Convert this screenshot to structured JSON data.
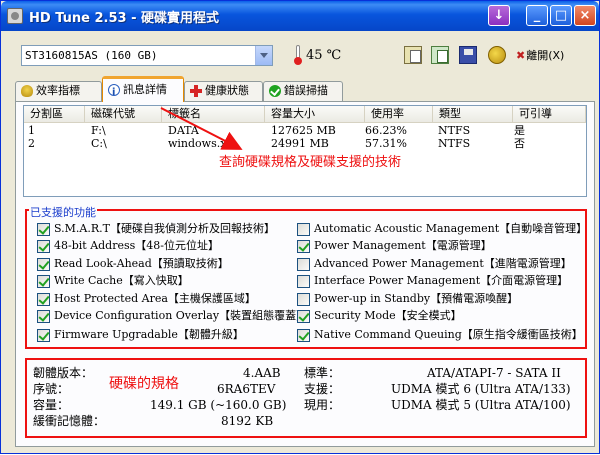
{
  "window": {
    "title": "HD Tune 2.53 - 硬碟實用程式"
  },
  "toolbar": {
    "drive": "ST3160815AS (160 GB)",
    "temperature": "45 ℃",
    "exit_label": "離開(X)",
    "icons": [
      "copy-text-icon",
      "copy-screenshot-icon",
      "save-icon",
      "options-icon"
    ]
  },
  "tabs": [
    {
      "label": "效率指標",
      "icon": "benchmark-icon",
      "selected": false
    },
    {
      "label": "訊息詳情",
      "icon": "info-icon",
      "selected": true
    },
    {
      "label": "健康狀態",
      "icon": "health-icon",
      "selected": false
    },
    {
      "label": "錯誤掃描",
      "icon": "error-scan-icon",
      "selected": false
    }
  ],
  "partitions": {
    "columns": [
      "分割區",
      "磁碟代號",
      "標籤名",
      "容量大小",
      "使用率",
      "類型",
      "可引導"
    ],
    "rows": [
      [
        "1",
        "F:\\",
        "DATA",
        "127625 MB",
        "66.23%",
        "NTFS",
        "是"
      ],
      [
        "2",
        "C:\\",
        "windows.xp",
        "24991 MB",
        "57.31%",
        "NTFS",
        "否"
      ]
    ]
  },
  "annotations": {
    "tab_note": "查詢硬碟規格及硬碟支援的技術",
    "spec_note": "硬碟的規格",
    "color": "#ee1111"
  },
  "features": {
    "title": "已支援的功能",
    "left": [
      {
        "label": "S.M.A.R.T【硬碟自我偵測分析及回報技術】",
        "checked": true
      },
      {
        "label": "48-bit Address【48-位元位址】",
        "checked": true
      },
      {
        "label": "Read Look-Ahead【預讀取技術】",
        "checked": true
      },
      {
        "label": "Write Cache【寫入快取】",
        "checked": true
      },
      {
        "label": "Host Protected Area【主機保護區域】",
        "checked": true
      },
      {
        "label": "Device Configuration Overlay【裝置組態覆蓋】",
        "checked": true
      },
      {
        "label": "Firmware Upgradable【韌體升級】",
        "checked": true
      }
    ],
    "right": [
      {
        "label": "Automatic Acoustic Management【自動噪音管理】",
        "checked": false
      },
      {
        "label": "Power Management【電源管理】",
        "checked": true
      },
      {
        "label": "Advanced Power Management【進階電源管理】",
        "checked": false
      },
      {
        "label": "Interface Power Management【介面電源管理】",
        "checked": false
      },
      {
        "label": "Power-up in Standby【預備電源喚醒】",
        "checked": false
      },
      {
        "label": "Security Mode【安全模式】",
        "checked": true
      },
      {
        "label": "Native Command Queuing【原生指令緩衝區技術】",
        "checked": true
      }
    ]
  },
  "info": {
    "firmware_label": "韌體版本：",
    "firmware_value": "4.AAB",
    "serial_label": "序號：",
    "serial_value": "6RA6TEV",
    "capacity_label": "容量：",
    "capacity_value": "149.1 GB (~160.0 GB)",
    "buffer_label": "緩衝記憶體：",
    "buffer_value": "8192 KB",
    "standard_label": "標準：",
    "standard_value": "ATA/ATAPI-7 - SATA II",
    "supported_label": "支援：",
    "supported_value": "UDMA 模式 6 (Ultra ATA/133)",
    "active_label": "現用：",
    "active_value": "UDMA 模式 5 (Ultra ATA/100)"
  }
}
